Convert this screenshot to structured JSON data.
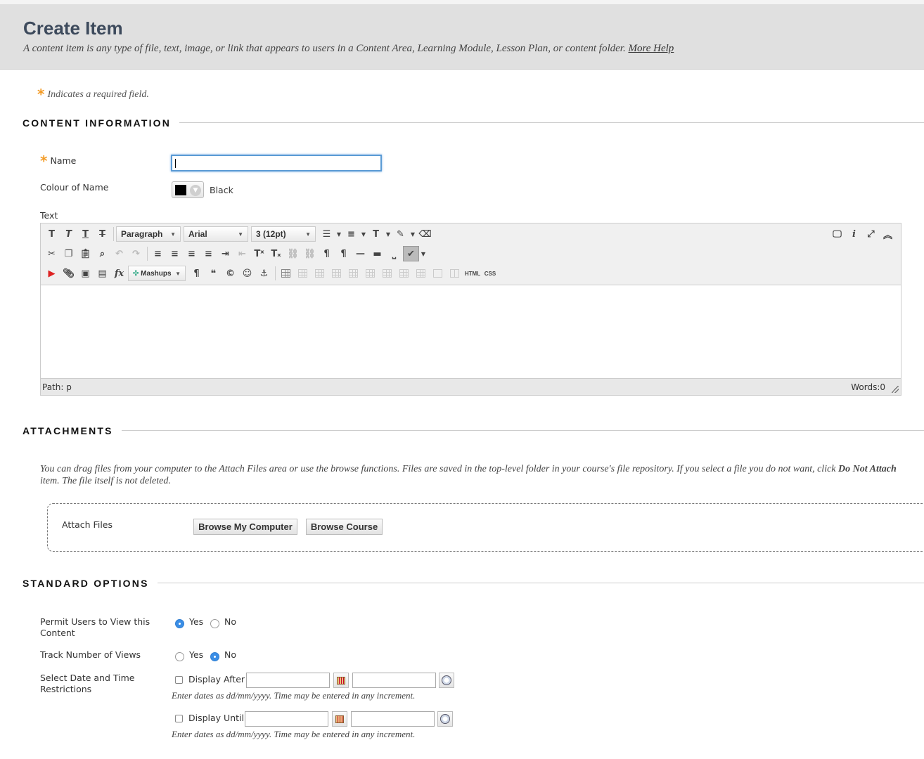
{
  "header": {
    "title": "Create Item",
    "description": "A content item is any type of file, text, image, or link that appears to users in a Content Area, Learning Module, Lesson Plan, or content folder.",
    "help_link": "More Help"
  },
  "required_note": "Indicates a required field.",
  "sections": {
    "content_information": "CONTENT INFORMATION",
    "attachments": "ATTACHMENTS",
    "standard_options": "STANDARD OPTIONS"
  },
  "content": {
    "name_label": "Name",
    "name_value": "",
    "colour_label": "Colour of Name",
    "colour_value": "Black",
    "colour_hex": "#000000",
    "text_label": "Text"
  },
  "editor": {
    "format_select": "Paragraph",
    "font_select": "Arial",
    "size_select": "3 (12pt)",
    "mashups_label": "Mashups",
    "html_label": "HTML",
    "css_label": "CSS",
    "path": "Path: p",
    "words": "Words:0"
  },
  "attachments": {
    "help_text_1": "You can drag files from your computer to the Attach Files area or use the browse functions. Files are saved in the top-level folder in your course's file repository.  If you select a file you do not want, click",
    "help_text_bold": "Do Not Attach",
    "help_text_2": "item. The file itself is not deleted.",
    "attach_label": "Attach Files",
    "browse_computer": "Browse My Computer",
    "browse_course": "Browse Course"
  },
  "options": {
    "permit_label": "Permit Users to View this Content",
    "track_label": "Track Number of Views",
    "date_label": "Select Date and Time Restrictions",
    "yes": "Yes",
    "no": "No",
    "permit_value": "Yes",
    "track_value": "No",
    "display_after": "Display After",
    "display_until": "Display Until",
    "date_hint": "Enter dates as dd/mm/yyyy. Time may be entered in any increment."
  },
  "colors": {
    "accent": "#3a8ee6",
    "required_star": "#f39a23",
    "header_bg": "#e0e0e0"
  }
}
